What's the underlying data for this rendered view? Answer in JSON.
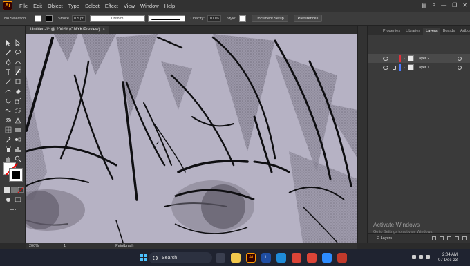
{
  "menubar": {
    "logo": "Ai",
    "items": [
      "File",
      "Edit",
      "Object",
      "Type",
      "Select",
      "Effect",
      "View",
      "Window",
      "Help"
    ]
  },
  "controlbar": {
    "selection": "No Selection",
    "stroke_label": "Stroke",
    "stroke_value": "0.5 pt",
    "brush_label": "Uniform",
    "opacity_label": "Opacity:",
    "opacity_value": "100%",
    "style_label": "Style:",
    "document_setup": "Document Setup",
    "preferences": "Preferences"
  },
  "document": {
    "tab_title": "Untitled-1* @ 200 % (CMYK/Preview)",
    "close": "×"
  },
  "panel": {
    "tabs": [
      "Properties",
      "Libraries",
      "Layers",
      "Boards",
      "Artboa"
    ],
    "active_tab": "Layers",
    "layers": [
      {
        "name": "Layer 2",
        "color": "#e0313b",
        "selected": true
      },
      {
        "name": "Layer 1",
        "color": "#4f7dff",
        "selected": false
      }
    ],
    "footer_count": "2 Layers"
  },
  "statusbar": {
    "zoom": "200%",
    "artboard": "1",
    "tool": "Paintbrush"
  },
  "watermark": {
    "title": "Activate Windows",
    "subtitle": "Go to Settings to activate Windows."
  },
  "taskbar": {
    "search_placeholder": "Search",
    "time": "2:04 AM",
    "date": "07-Dec-23"
  },
  "colors": {
    "canvas_bg": "#b6b2c4",
    "accent": "#ff9a00",
    "ui_dark": "#323232"
  }
}
